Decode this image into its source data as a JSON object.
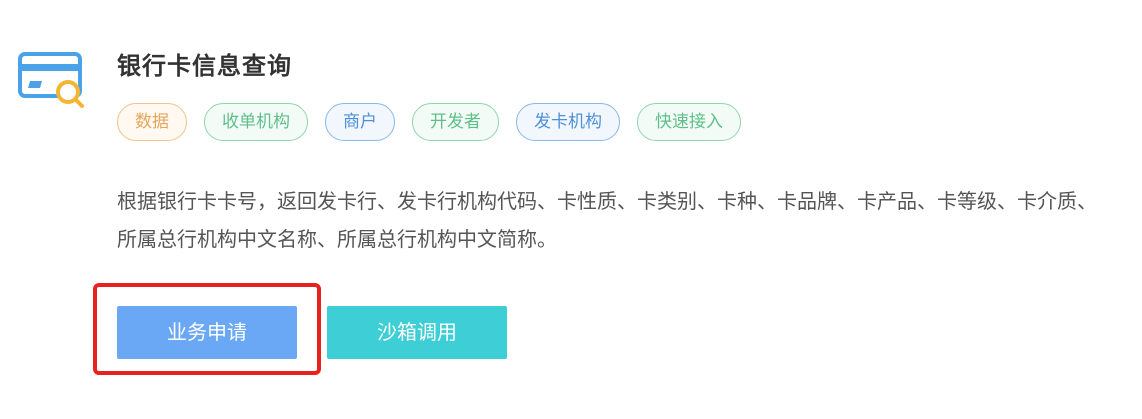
{
  "product": {
    "title": "银行卡信息查询",
    "icon": "bank-card-search-icon",
    "tags": [
      {
        "label": "数据",
        "color": "#e5a55c"
      },
      {
        "label": "收单机构",
        "color": "#5fbf8a"
      },
      {
        "label": "商户",
        "color": "#4f8fd6"
      },
      {
        "label": "开发者",
        "color": "#5fbf8a"
      },
      {
        "label": "发卡机构",
        "color": "#4f8fd6"
      },
      {
        "label": "快速接入",
        "color": "#5fbf8a"
      }
    ],
    "description": "根据银行卡卡号，返回发卡行、发卡行机构代码、卡性质、卡类别、卡种、卡品牌、卡产品、卡等级、卡介质、所属总行机构中文名称、所属总行机构中文简称。"
  },
  "actions": {
    "apply_label": "业务申请",
    "sandbox_label": "沙箱调用"
  },
  "colors": {
    "apply_button": "#6aa8f5",
    "sandbox_button": "#3dced6",
    "highlight_box": "#e8231f"
  }
}
